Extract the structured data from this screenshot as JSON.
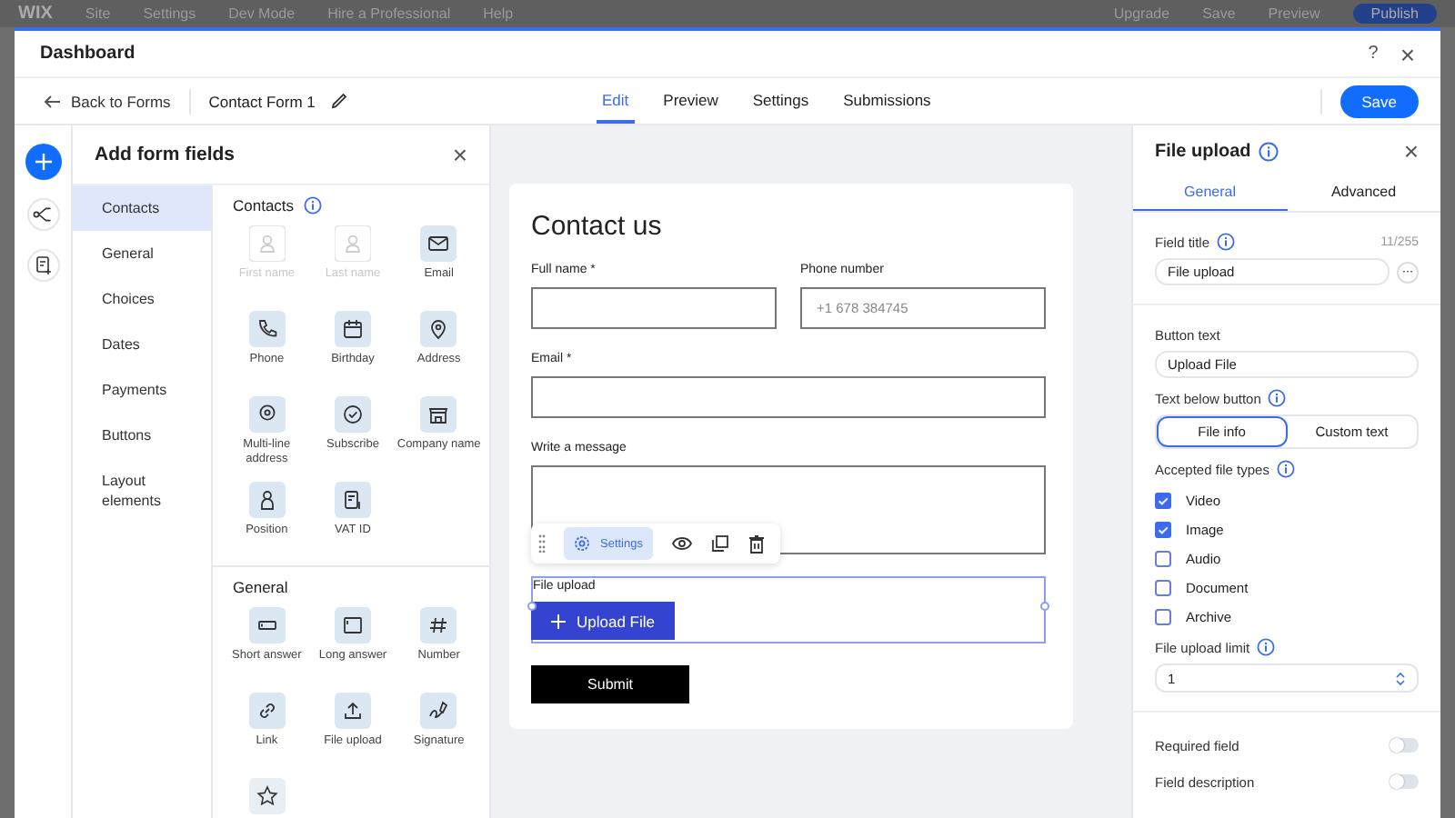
{
  "editor_bar": {
    "logo": "WIX",
    "menu": [
      "Site",
      "Settings",
      "Dev Mode",
      "Hire a Professional",
      "Help"
    ],
    "actions": [
      "Upgrade",
      "Save",
      "Preview"
    ],
    "publish": "Publish"
  },
  "window": {
    "title": "Dashboard",
    "help": "?",
    "close": "×"
  },
  "toolbar": {
    "back": "Back to Forms",
    "form_name": "Contact Form 1",
    "tabs": [
      {
        "label": "Edit",
        "selected": true
      },
      {
        "label": "Preview",
        "selected": false
      },
      {
        "label": "Settings",
        "selected": false
      },
      {
        "label": "Submissions",
        "selected": false
      }
    ],
    "save": "Save"
  },
  "add_panel": {
    "title": "Add form fields",
    "close": "×",
    "categories": [
      {
        "label": "Contacts",
        "selected": true
      },
      {
        "label": "General",
        "selected": false
      },
      {
        "label": "Choices",
        "selected": false
      },
      {
        "label": "Dates",
        "selected": false
      },
      {
        "label": "Payments",
        "selected": false
      },
      {
        "label": "Buttons",
        "selected": false
      },
      {
        "label": "Layout elements",
        "selected": false
      }
    ],
    "sections": [
      {
        "title": "Contacts",
        "info": true,
        "items": [
          {
            "label": "First name",
            "disabled": true
          },
          {
            "label": "Last name",
            "disabled": true
          },
          {
            "label": "Email",
            "disabled": false
          },
          {
            "label": "Phone",
            "disabled": false
          },
          {
            "label": "Birthday",
            "disabled": false
          },
          {
            "label": "Address",
            "disabled": false
          },
          {
            "label": "Multi-line address",
            "disabled": false
          },
          {
            "label": "Subscribe",
            "disabled": false
          },
          {
            "label": "Company name",
            "disabled": false
          },
          {
            "label": "Position",
            "disabled": false
          },
          {
            "label": "VAT ID",
            "disabled": false
          }
        ]
      },
      {
        "title": "General",
        "info": false,
        "items": [
          {
            "label": "Short answer",
            "disabled": false
          },
          {
            "label": "Long answer",
            "disabled": false
          },
          {
            "label": "Number",
            "disabled": false
          },
          {
            "label": "Link",
            "disabled": false
          },
          {
            "label": "File upload",
            "disabled": false
          },
          {
            "label": "Signature",
            "disabled": false
          }
        ]
      }
    ]
  },
  "form": {
    "title": "Contact us",
    "fields": [
      {
        "kind": "text",
        "label": "Full name *",
        "half": true
      },
      {
        "kind": "text",
        "label": "Phone number",
        "placeholder": "+1 678 384745",
        "half": true
      },
      {
        "kind": "text",
        "label": "Email *",
        "half": false
      },
      {
        "kind": "textarea",
        "label": "Write a message",
        "half": false
      },
      {
        "kind": "file",
        "label": "File upload",
        "button": "Upload File",
        "half": false,
        "selected": true
      }
    ],
    "field_toolbar": {
      "settings": "Settings"
    },
    "submit": "Submit"
  },
  "settings_panel": {
    "title": "File upload",
    "close": "×",
    "tabs": [
      {
        "label": "General",
        "selected": true
      },
      {
        "label": "Advanced",
        "selected": false
      }
    ],
    "field_title": {
      "label": "Field title",
      "counter": "11/255",
      "value": "File upload",
      "more": "···"
    },
    "button_text": {
      "label": "Button text",
      "value": "Upload File"
    },
    "text_below": {
      "label": "Text below button",
      "options": [
        {
          "label": "File info",
          "selected": true
        },
        {
          "label": "Custom text",
          "selected": false
        }
      ]
    },
    "file_types": {
      "label": "Accepted file types",
      "options": [
        {
          "label": "Video",
          "checked": true
        },
        {
          "label": "Image",
          "checked": true
        },
        {
          "label": "Audio",
          "checked": false
        },
        {
          "label": "Document",
          "checked": false
        },
        {
          "label": "Archive",
          "checked": false
        }
      ]
    },
    "upload_limit": {
      "label": "File upload limit",
      "value": "1"
    },
    "toggles": [
      {
        "label": "Required field",
        "on": false
      },
      {
        "label": "Field description",
        "on": false
      }
    ]
  }
}
